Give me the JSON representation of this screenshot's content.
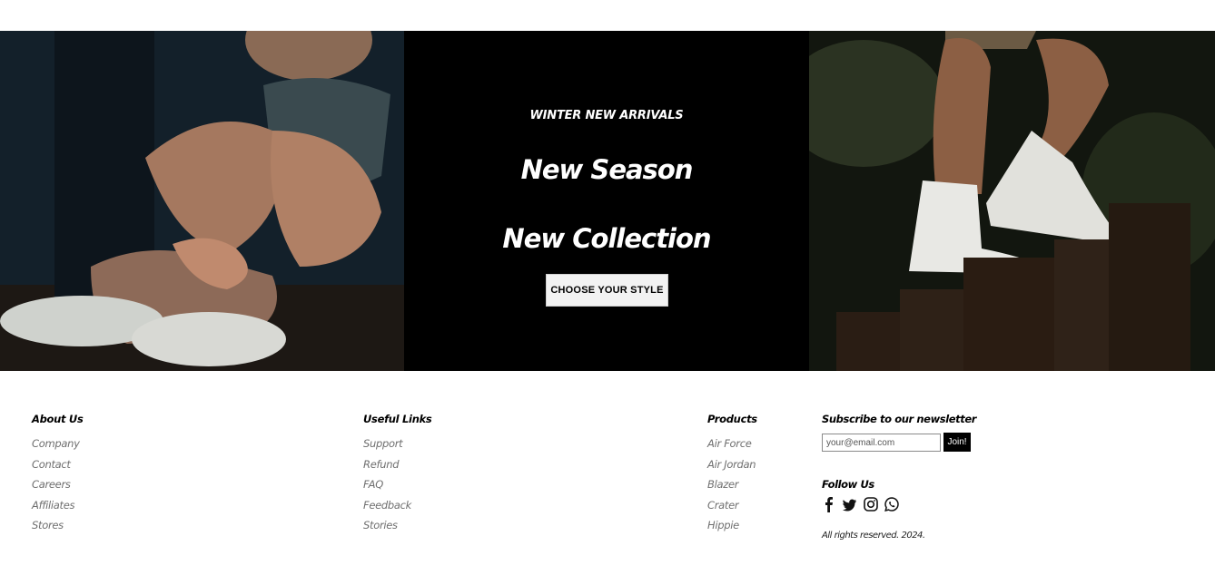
{
  "hero": {
    "kicker": "WINTER NEW ARRIVALS",
    "headline_1": "New Season",
    "headline_2": "New Collection",
    "cta_label": "CHOOSE YOUR STYLE"
  },
  "images": {
    "left": "woman-tying-sneakers-photo",
    "right": "white-high-top-sneakers-photo"
  },
  "footer": {
    "about": {
      "title": "About Us",
      "links": [
        "Company",
        "Contact",
        "Careers",
        "Affiliates",
        "Stores"
      ]
    },
    "useful": {
      "title": "Useful Links",
      "links": [
        "Support",
        "Refund",
        "FAQ",
        "Feedback",
        "Stories"
      ]
    },
    "products": {
      "title": "Products",
      "links": [
        "Air Force",
        "Air Jordan",
        "Blazer",
        "Crater",
        "Hippie"
      ]
    },
    "newsletter": {
      "title": "Subscribe to our newsletter",
      "placeholder": "your@email.com",
      "button": "Join!"
    },
    "follow": {
      "title": "Follow Us",
      "icons": [
        "facebook-icon",
        "twitter-icon",
        "instagram-icon",
        "whatsapp-icon"
      ]
    },
    "rights": "All rights reserved. 2024."
  }
}
